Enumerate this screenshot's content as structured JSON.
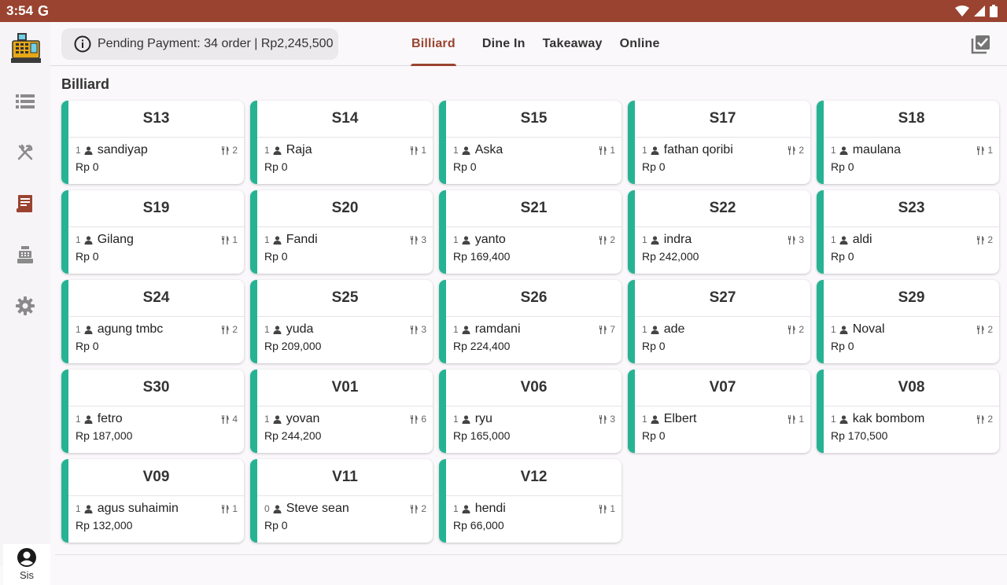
{
  "status_bar": {
    "time": "3:54",
    "g_label": "G"
  },
  "sidebar": {
    "items": [
      {
        "icon": "list-icon"
      },
      {
        "icon": "utensils-icon"
      },
      {
        "icon": "receipt-icon"
      },
      {
        "icon": "cash-register-icon"
      },
      {
        "icon": "gear-icon"
      }
    ],
    "user_name": "Sis"
  },
  "header": {
    "pending_text": "Pending Payment: 34 order | Rp2,245,500",
    "tabs": [
      {
        "label": "Billiard",
        "active": true
      },
      {
        "label": "Dine In"
      },
      {
        "label": "Takeaway"
      },
      {
        "label": "Online"
      }
    ]
  },
  "section_title": "Billiard",
  "accent_color": "#26b394",
  "brand_color": "#9a4330",
  "tables": [
    {
      "name": "S13",
      "guests": "1",
      "customer": "sandiyap",
      "items": "2",
      "total": "Rp 0"
    },
    {
      "name": "S14",
      "guests": "1",
      "customer": "Raja",
      "items": "1",
      "total": "Rp 0"
    },
    {
      "name": "S15",
      "guests": "1",
      "customer": "Aska",
      "items": "1",
      "total": "Rp 0"
    },
    {
      "name": "S17",
      "guests": "1",
      "customer": "fathan qoribi",
      "items": "2",
      "total": "Rp 0"
    },
    {
      "name": "S18",
      "guests": "1",
      "customer": "maulana",
      "items": "1",
      "total": "Rp 0"
    },
    {
      "name": "S19",
      "guests": "1",
      "customer": "Gilang",
      "items": "1",
      "total": "Rp 0"
    },
    {
      "name": "S20",
      "guests": "1",
      "customer": "Fandi",
      "items": "3",
      "total": "Rp 0"
    },
    {
      "name": "S21",
      "guests": "1",
      "customer": "yanto",
      "items": "2",
      "total": "Rp 169,400"
    },
    {
      "name": "S22",
      "guests": "1",
      "customer": "indra",
      "items": "3",
      "total": "Rp 242,000"
    },
    {
      "name": "S23",
      "guests": "1",
      "customer": "aldi",
      "items": "2",
      "total": "Rp 0"
    },
    {
      "name": "S24",
      "guests": "1",
      "customer": "agung tmbc",
      "items": "2",
      "total": "Rp 0"
    },
    {
      "name": "S25",
      "guests": "1",
      "customer": "yuda",
      "items": "3",
      "total": "Rp 209,000"
    },
    {
      "name": "S26",
      "guests": "1",
      "customer": "ramdani",
      "items": "7",
      "total": "Rp 224,400"
    },
    {
      "name": "S27",
      "guests": "1",
      "customer": "ade",
      "items": "2",
      "total": "Rp 0"
    },
    {
      "name": "S29",
      "guests": "1",
      "customer": "Noval",
      "items": "2",
      "total": "Rp 0"
    },
    {
      "name": "S30",
      "guests": "1",
      "customer": "fetro",
      "items": "4",
      "total": "Rp 187,000"
    },
    {
      "name": "V01",
      "guests": "1",
      "customer": "yovan",
      "items": "6",
      "total": "Rp 244,200"
    },
    {
      "name": "V06",
      "guests": "1",
      "customer": "ryu",
      "items": "3",
      "total": "Rp 165,000"
    },
    {
      "name": "V07",
      "guests": "1",
      "customer": "Elbert",
      "items": "1",
      "total": "Rp 0"
    },
    {
      "name": "V08",
      "guests": "1",
      "customer": "kak bombom",
      "items": "2",
      "total": "Rp 170,500"
    },
    {
      "name": "V09",
      "guests": "1",
      "customer": "agus suhaimin",
      "items": "1",
      "total": "Rp 132,000"
    },
    {
      "name": "V11",
      "guests": "0",
      "customer": "Steve sean",
      "items": "2",
      "total": "Rp 0"
    },
    {
      "name": "V12",
      "guests": "1",
      "customer": "hendi",
      "items": "1",
      "total": "Rp 66,000"
    }
  ]
}
